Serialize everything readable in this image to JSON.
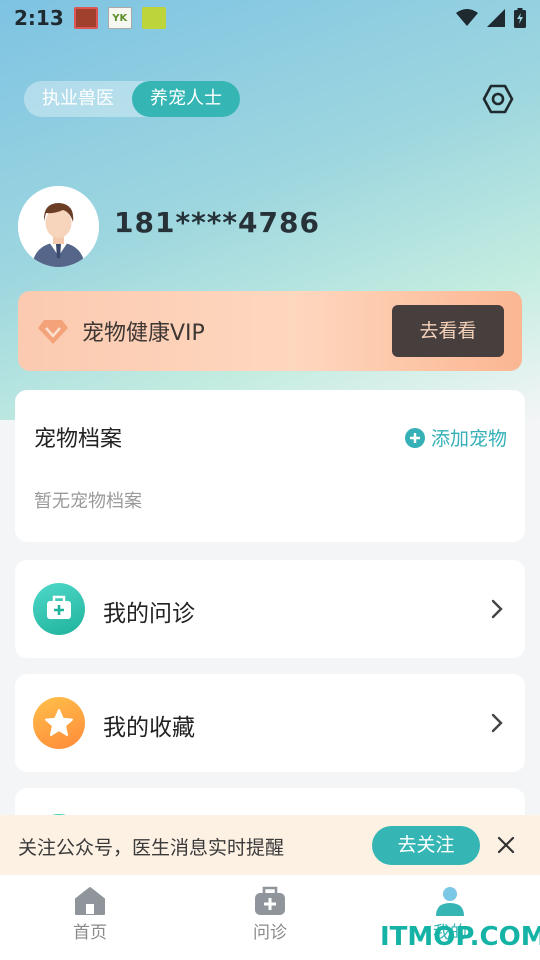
{
  "status_bar": {
    "time": "2:13"
  },
  "role_switch": {
    "tabs": [
      "执业兽医",
      "养宠人士"
    ],
    "active_index": 1
  },
  "profile": {
    "phone": "181****4786"
  },
  "vip": {
    "title": "宠物健康VIP",
    "button": "去看看"
  },
  "pets": {
    "title": "宠物档案",
    "add_label": "添加宠物",
    "empty_text": "暂无宠物档案"
  },
  "menu": [
    {
      "label": "我的问诊",
      "icon": "medical-kit-icon"
    },
    {
      "label": "我的收藏",
      "icon": "star-icon"
    }
  ],
  "follow_bar": {
    "text": "关注公众号，医生消息实时提醒",
    "button": "去关注"
  },
  "tabbar": {
    "items": [
      "首页",
      "问诊",
      "我的"
    ],
    "active_index": 2
  },
  "watermark": "ITMOP.COM",
  "colors": {
    "accent": "#35b6b5",
    "vip_button_bg": "#473e3e",
    "follow_bar_bg": "#fdf1e4"
  }
}
